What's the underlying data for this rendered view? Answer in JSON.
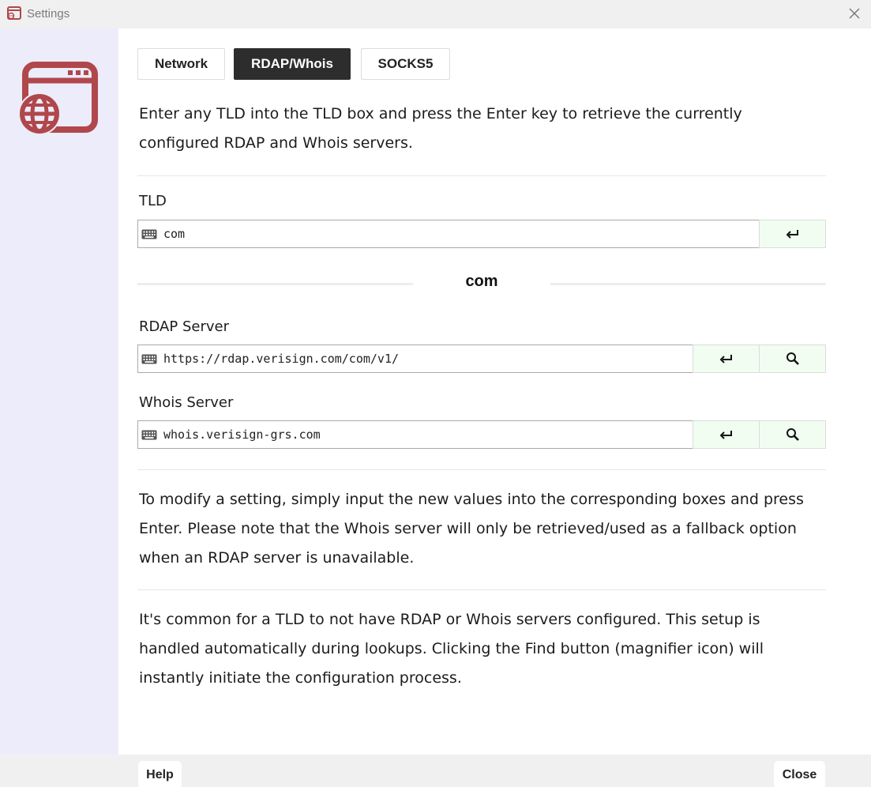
{
  "window": {
    "title": "Settings",
    "icons": {
      "app": "settings-window-icon",
      "close": "close-icon",
      "logo": "browser-globe-icon"
    }
  },
  "tabs": [
    {
      "label": "Network",
      "active": false
    },
    {
      "label": "RDAP/Whois",
      "active": true
    },
    {
      "label": "SOCKS5",
      "active": false
    }
  ],
  "intro": {
    "line1": "Enter any TLD into the TLD box and press the Enter key to retrieve the currently",
    "line2": "configured RDAP and Whois servers."
  },
  "tld": {
    "label": "TLD",
    "value": "com",
    "enter_icon": "enter-icon",
    "heading": "com"
  },
  "rdap": {
    "label": "RDAP Server",
    "value": "https://rdap.verisign.com/com/v1/",
    "enter_icon": "enter-icon",
    "find_icon": "magnifier-icon"
  },
  "whois": {
    "label": "Whois Server",
    "value": "whois.verisign-grs.com",
    "enter_icon": "enter-icon",
    "find_icon": "magnifier-icon"
  },
  "modify_note": {
    "line1": "To modify a setting, simply input the new values into the corresponding boxes and press",
    "line2": "Enter. Please note that the Whois server will only be retrieved/used as a fallback option",
    "line3": "when an RDAP server is unavailable."
  },
  "common_note": {
    "line1": "It's common for a TLD to not have RDAP or Whois servers configured. This setup is",
    "line2": "handled automatically during lookups. Clicking the Find button (magnifier icon) will",
    "line3": "instantly initiate the configuration process."
  },
  "footer": {
    "help_label": "Help",
    "close_label": "Close"
  },
  "colors": {
    "accent": "#b0474b",
    "sidebar_bg": "#ececfb",
    "active_tab_bg": "#2d2d2d",
    "action_button_bg": "#f1fdf1"
  }
}
